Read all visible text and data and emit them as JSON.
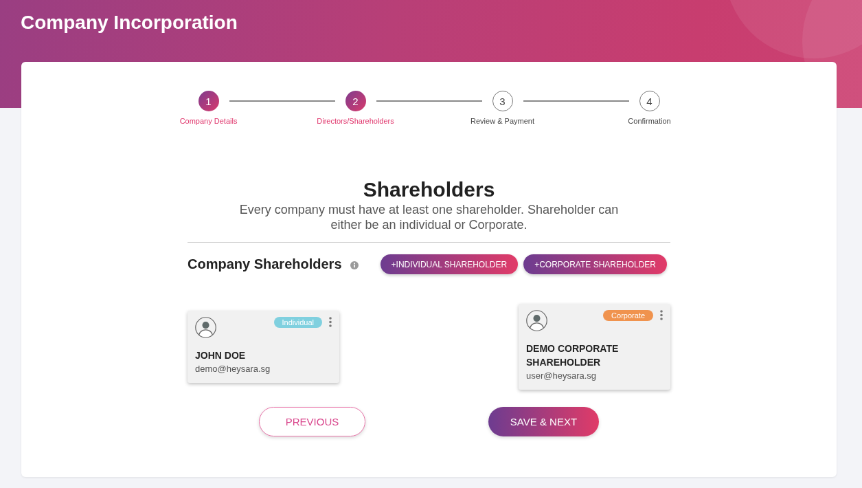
{
  "header": {
    "title": "Company Incorporation"
  },
  "stepper": {
    "steps": [
      {
        "number": "1",
        "label": "Company Details",
        "active": true
      },
      {
        "number": "2",
        "label": "Directors/Shareholders",
        "active": true
      },
      {
        "number": "3",
        "label": "Review & Payment",
        "active": false
      },
      {
        "number": "4",
        "label": "Confirmation",
        "active": false
      }
    ]
  },
  "section": {
    "title": "Shareholders",
    "description": "Every company must have at least one shareholder. Shareholder can either be an individual or Corporate."
  },
  "shareholders_panel": {
    "title": "Company Shareholders",
    "buttons": [
      "+INDIVIDUAL SHAREHOLDER",
      "+CORPORATE SHAREHOLDER"
    ]
  },
  "shareholders": [
    {
      "badge": "Individual",
      "color": "#80d0df",
      "name": "JOHN DOE",
      "email": "demo@heysara.sg"
    },
    {
      "badge": "Corporate",
      "color": "#f0934e",
      "name": "DEMO CORPORATE SHAREHOLDER",
      "email": "user@heysara.sg"
    }
  ],
  "footer_buttons": [
    {
      "label": "PREVIOUS",
      "kind": "outline"
    },
    {
      "label": "SAVE & NEXT",
      "kind": "primary"
    }
  ]
}
